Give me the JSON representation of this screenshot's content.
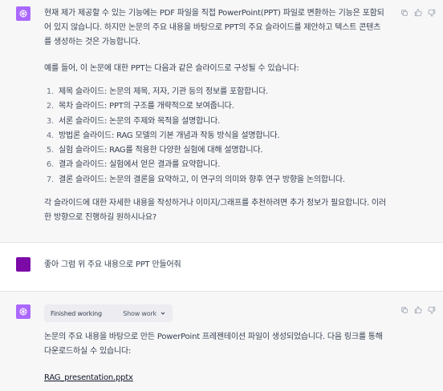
{
  "messages": {
    "first": {
      "intro": "현재 제가 제공할 수 있는 기능에는 PDF 파일을 직접 PowerPoint(PPT) 파일로 변환하는 기능은 포함되어 있지 않습니다. 하지만 논문의 주요 내용을 바탕으로 PPT의 주요 슬라이드를 제안하고 텍스트 콘텐츠를 생성하는 것은 가능합니다.",
      "lead": "예를 들어, 이 논문에 대한 PPT는 다음과 같은 슬라이드로 구성될 수 있습니다:",
      "items": [
        {
          "num": "1.",
          "text": "제목 슬라이드: 논문의 제목, 저자, 기관 등의 정보를 포함합니다."
        },
        {
          "num": "2.",
          "text": "목차 슬라이드: PPT의 구조를 개략적으로 보여줍니다."
        },
        {
          "num": "3.",
          "text": "서론 슬라이드: 논문의 주제와 목적을 설명합니다."
        },
        {
          "num": "4.",
          "text": "방법론 슬라이드: RAG 모델의 기본 개념과 작동 방식을 설명합니다."
        },
        {
          "num": "5.",
          "text": "실험 슬라이드: RAG를 적용한 다양한 실험에 대해 설명합니다."
        },
        {
          "num": "6.",
          "text": "결과 슬라이드: 실험에서 얻은 결과를 요약합니다."
        },
        {
          "num": "7.",
          "text": "결론 슬라이드: 논문의 결론을 요약하고, 이 연구의 의미와 향후 연구 방향을 논의합니다."
        }
      ],
      "outro": "각 슬라이드에 대한 자세한 내용을 작성하거나 이미지/그래프를 추천하려면 추가 정보가 필요합니다. 이러한 방향으로 진행하길 원하시나요?"
    },
    "user": {
      "text": "좋아 그럼 위 주요 내용으로 PPT 만들어줘"
    },
    "second": {
      "working_label": "Finished working",
      "show_work_label": "Show work",
      "text": "논문의 주요 내용을 바탕으로 만든 PowerPoint 프레젠테이션 파일이 생성되었습니다. 다음 링크를 통해 다운로드하실 수 있습니다:",
      "link_text": "RAG_presentation.pptx"
    }
  },
  "colors": {
    "assistant_avatar": "#ab68ff",
    "user_avatar": "#7c0aa6",
    "assistant_bg": "#f7f7f8"
  },
  "icons": [
    "openai-logo-icon",
    "copy-icon",
    "thumbs-up-icon",
    "thumbs-down-icon",
    "chevron-down-icon"
  ]
}
